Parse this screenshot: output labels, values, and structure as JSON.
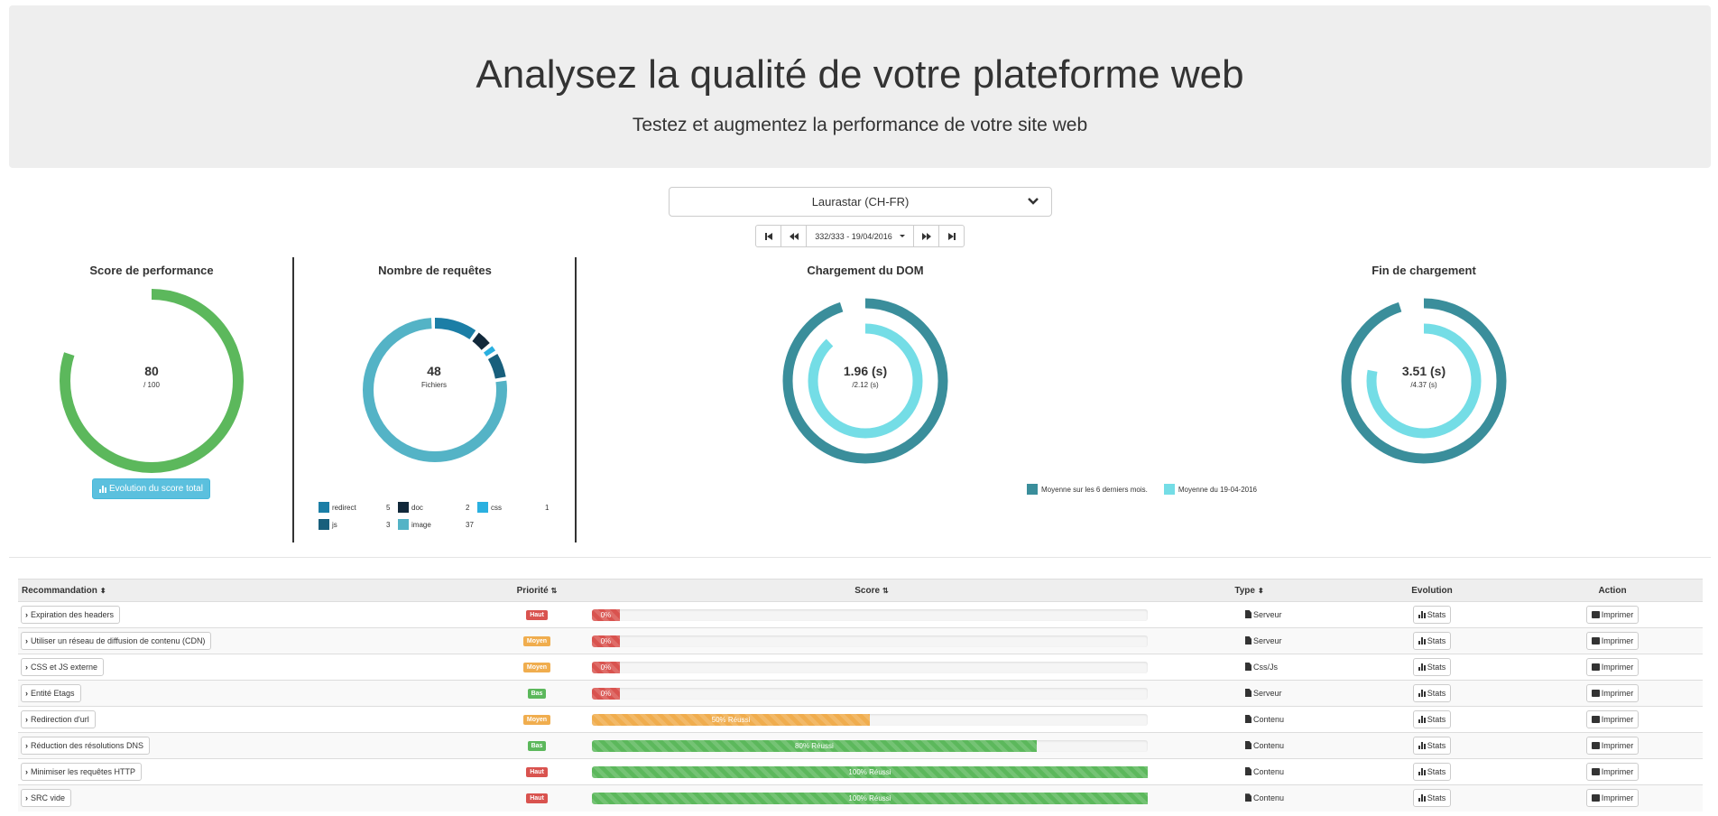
{
  "header": {
    "title": "Analysez la qualité de votre plateforme web",
    "subtitle": "Testez et augmentez la performance de votre site web"
  },
  "site_select": {
    "value": "Laurastar (CH-FR)"
  },
  "pager": {
    "current": "332/333 - 19/04/2016"
  },
  "performance": {
    "title": "Score de performance",
    "value": "80",
    "max": "/ 100",
    "score_fraction": 0.8,
    "color": "#5cb85c",
    "button_label": "Evolution du score total"
  },
  "requests": {
    "title": "Nombre de requêtes",
    "value": "48",
    "unit": "Fichiers",
    "segments": [
      {
        "name": "redirect",
        "count": 5,
        "color": "#1b7ea6"
      },
      {
        "name": "doc",
        "count": 2,
        "color": "#11283a"
      },
      {
        "name": "css",
        "count": 1,
        "color": "#2ab0e0"
      },
      {
        "name": "js",
        "count": 3,
        "color": "#185f7c"
      },
      {
        "name": "image",
        "count": 37,
        "color": "#54b3c6"
      }
    ],
    "legend_row1": [
      {
        "label": "redirect",
        "count": "5",
        "color": "#1b7ea6"
      },
      {
        "label": "doc",
        "count": "2",
        "color": "#11283a"
      },
      {
        "label": "css",
        "count": "1",
        "color": "#2ab0e0"
      }
    ],
    "legend_row2": [
      {
        "label": "js",
        "count": "3",
        "color": "#185f7c"
      },
      {
        "label": "image",
        "count": "37",
        "color": "#54b3c6"
      }
    ]
  },
  "dom": {
    "title": "Chargement du DOM",
    "value": "1.96 (s)",
    "avg": "/2.12 (s)",
    "avg_fraction": 0.95,
    "day_fraction": 0.88
  },
  "load": {
    "title": "Fin de chargement",
    "value": "3.51 (s)",
    "avg": "/4.37 (s)",
    "avg_fraction": 0.95,
    "day_fraction": 0.78
  },
  "time_legend": {
    "avg_label": "Moyenne sur les 6 derniers mois.",
    "avg_color": "#3a8e9b",
    "day_label": "Moyenne du 19-04-2016",
    "day_color": "#74dde6"
  },
  "table": {
    "headers": {
      "recommandation": "Recommandation",
      "priorite": "Priorité",
      "score": "Score",
      "type": "Type",
      "evolution": "Evolution",
      "action": "Action"
    },
    "stats_label": "Stats",
    "print_label": "Imprimer",
    "rows": [
      {
        "name": "Expiration des headers",
        "priority": "Haut",
        "prio_color": "#d9534f",
        "score": 0,
        "score_label": "0%",
        "bar_color": "#d9534f",
        "type": "Serveur"
      },
      {
        "name": "Utiliser un réseau de diffusion de contenu (CDN)",
        "priority": "Moyen",
        "prio_color": "#f0ad4e",
        "score": 0,
        "score_label": "0%",
        "bar_color": "#d9534f",
        "type": "Serveur"
      },
      {
        "name": "CSS et JS externe",
        "priority": "Moyen",
        "prio_color": "#f0ad4e",
        "score": 0,
        "score_label": "0%",
        "bar_color": "#d9534f",
        "type": "Css/Js"
      },
      {
        "name": "Entité Etags",
        "priority": "Bas",
        "prio_color": "#5cb85c",
        "score": 0,
        "score_label": "0%",
        "bar_color": "#d9534f",
        "type": "Serveur"
      },
      {
        "name": "Redirection d'url",
        "priority": "Moyen",
        "prio_color": "#f0ad4e",
        "score": 50,
        "score_label": "50% Réussi",
        "bar_color": "#f0ad4e",
        "type": "Contenu"
      },
      {
        "name": "Réduction des résolutions DNS",
        "priority": "Bas",
        "prio_color": "#5cb85c",
        "score": 80,
        "score_label": "80% Réussi",
        "bar_color": "#5cb85c",
        "type": "Contenu"
      },
      {
        "name": "Minimiser les requêtes HTTP",
        "priority": "Haut",
        "prio_color": "#d9534f",
        "score": 100,
        "score_label": "100% Réussi",
        "bar_color": "#5cb85c",
        "type": "Contenu"
      },
      {
        "name": "SRC vide",
        "priority": "Haut",
        "prio_color": "#d9534f",
        "score": 100,
        "score_label": "100% Réussi",
        "bar_color": "#5cb85c",
        "type": "Contenu"
      }
    ]
  }
}
